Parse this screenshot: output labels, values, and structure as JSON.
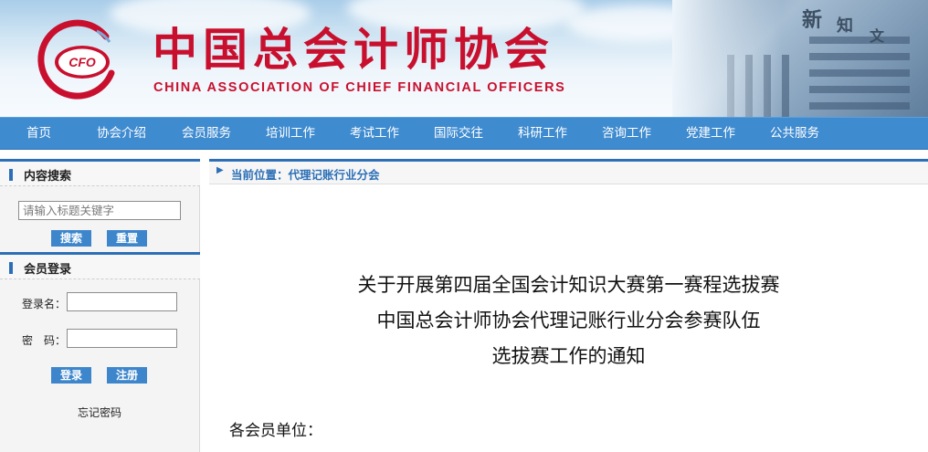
{
  "header": {
    "logo_text": "CFO",
    "title_cn": "中国总会计师协会",
    "title_en": "CHINA ASSOCIATION OF CHIEF FINANCIAL OFFICERS",
    "brand_color": "#c8102e"
  },
  "nav": {
    "items": [
      {
        "label": "首页"
      },
      {
        "label": "协会介绍"
      },
      {
        "label": "会员服务"
      },
      {
        "label": "培训工作"
      },
      {
        "label": "考试工作"
      },
      {
        "label": "国际交往"
      },
      {
        "label": "科研工作"
      },
      {
        "label": "咨询工作"
      },
      {
        "label": "党建工作"
      },
      {
        "label": "公共服务"
      }
    ],
    "bg_color": "#3f8bd0"
  },
  "sidebar": {
    "search": {
      "heading": "内容搜索",
      "placeholder": "请输入标题关键字",
      "search_label": "搜索",
      "reset_label": "重置"
    },
    "login": {
      "heading": "会员登录",
      "username_label": "登录名：",
      "password_label": "密　码：",
      "login_label": "登录",
      "register_label": "注册",
      "forgot_label": "忘记密码"
    }
  },
  "main": {
    "breadcrumb": "当前位置：代理记账行业分会",
    "article": {
      "title_lines": [
        "关于开展第四届全国会计知识大赛第一赛程选拔赛",
        "中国总会计师协会代理记账行业分会参赛队伍",
        "选拔赛工作的通知"
      ],
      "greeting": "各会员单位："
    }
  },
  "icons": {
    "breadcrumb": "triangle-right-icon",
    "section_marker": "vertical-bar-icon"
  }
}
